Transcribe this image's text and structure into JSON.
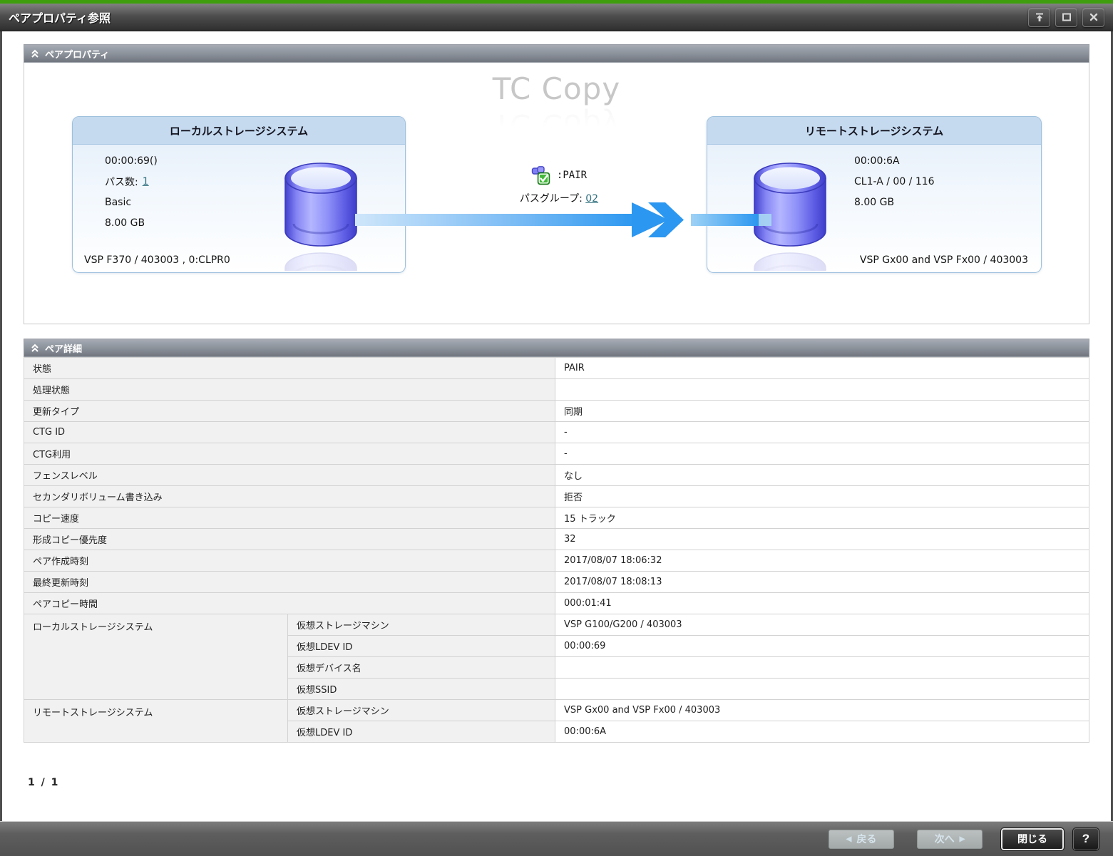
{
  "window": {
    "title": "ペアプロパティ参照"
  },
  "pair_property": {
    "header": "ペアプロパティ",
    "watermark": "TC Copy",
    "local": {
      "title": "ローカルストレージシステム",
      "ldev": "00:00:69()",
      "path_label": "パス数:",
      "path_count": "1",
      "provisioning": "Basic",
      "capacity": "8.00 GB",
      "system": "VSP F370 / 403003 , 0:CLPR0"
    },
    "pair": {
      "status_label": ":PAIR",
      "path_group_label": "パスグループ:",
      "path_group": "02"
    },
    "remote": {
      "title": "リモートストレージシステム",
      "ldev": "00:00:6A",
      "port": "CL1-A / 00 / 116",
      "capacity": "8.00 GB",
      "system": "VSP Gx00 and VSP Fx00 / 403003"
    }
  },
  "pair_detail": {
    "header": "ペア詳細",
    "rows": [
      {
        "label": "状態",
        "value": "PAIR"
      },
      {
        "label": "処理状態",
        "value": ""
      },
      {
        "label": "更新タイプ",
        "value": "同期"
      },
      {
        "label": "CTG ID",
        "value": "-"
      },
      {
        "label": "CTG利用",
        "value": "-"
      },
      {
        "label": "フェンスレベル",
        "value": "なし"
      },
      {
        "label": "セカンダリボリューム書き込み",
        "value": "拒否"
      },
      {
        "label": "コピー速度",
        "value": "15 トラック"
      },
      {
        "label": "形成コピー優先度",
        "value": "32"
      },
      {
        "label": "ペア作成時刻",
        "value": "2017/08/07 18:06:32"
      },
      {
        "label": "最終更新時刻",
        "value": "2017/08/07 18:08:13"
      },
      {
        "label": "ペアコピー時間",
        "value": "000:01:41"
      }
    ],
    "groups": [
      {
        "label": "ローカルストレージシステム",
        "rows": [
          {
            "label": "仮想ストレージマシン",
            "value": "VSP G100/G200 / 403003"
          },
          {
            "label": "仮想LDEV ID",
            "value": "00:00:69"
          },
          {
            "label": "仮想デバイス名",
            "value": ""
          },
          {
            "label": "仮想SSID",
            "value": ""
          }
        ]
      },
      {
        "label": "リモートストレージシステム",
        "rows": [
          {
            "label": "仮想ストレージマシン",
            "value": "VSP Gx00 and VSP Fx00 / 403003"
          },
          {
            "label": "仮想LDEV ID",
            "value": "00:00:6A"
          }
        ]
      }
    ]
  },
  "pagination": "1 / 1",
  "footer": {
    "back": "戻る",
    "back_icon": "◀",
    "next": "次へ",
    "next_icon": "▶",
    "close": "閉じる",
    "help": "?"
  },
  "colors": {
    "accent_green": "#3f9e0e",
    "arrow_blue": "#2b97f0",
    "link_teal": "#2f6f7e",
    "box_header_blue": "#c5daef"
  }
}
